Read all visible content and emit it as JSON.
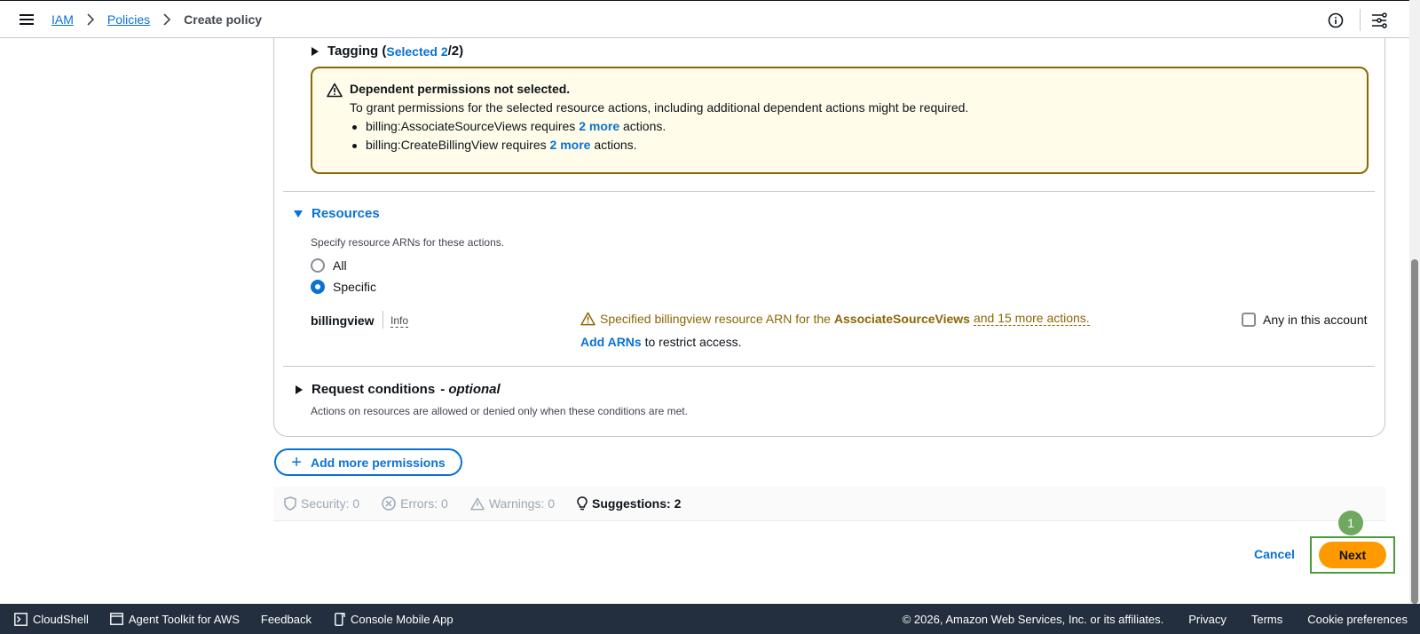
{
  "breadcrumb": {
    "items": [
      "IAM",
      "Policies"
    ],
    "current": "Create policy"
  },
  "tagging": {
    "label": "Tagging (",
    "selected": "Selected 2",
    "suffix": "/2)"
  },
  "alert": {
    "title": "Dependent permissions not selected.",
    "text": "To grant permissions for the selected resource actions, including additional dependent actions might be required.",
    "items": [
      {
        "action": "billing:AssociateSourceViews requires ",
        "link": "2 more",
        "after": " actions."
      },
      {
        "action": "billing:CreateBillingView requires ",
        "link": "2 more",
        "after": " actions."
      }
    ]
  },
  "resources": {
    "heading": "Resources",
    "description": "Specify resource ARNs for these actions.",
    "options": [
      "All",
      "Specific"
    ],
    "selected": "Specific",
    "billingview": {
      "label": "billingview",
      "info": "Info",
      "warning_prefix": "Specified billingview resource ARN for the",
      "warning_action": "AssociateSourceViews",
      "warning_more": "and 15 more actions.",
      "add_arns": "Add ARNs",
      "add_arns_suffix": " to restrict access.",
      "any_account": "Any in this account"
    }
  },
  "request_conditions": {
    "heading": "Request conditions",
    "optional": "- optional",
    "description": "Actions on resources are allowed or denied only when these conditions are met."
  },
  "add_more_permissions": "Add more permissions",
  "summary": {
    "security": "Security: 0",
    "errors": "Errors: 0",
    "warnings": "Warnings: 0",
    "suggestions": "Suggestions: 2"
  },
  "actions": {
    "cancel": "Cancel",
    "next": "Next",
    "step_badge": "1"
  },
  "footer": {
    "cloudshell": "CloudShell",
    "agent_toolkit": "Agent Toolkit for AWS",
    "feedback": "Feedback",
    "mobile_app": "Console Mobile App",
    "copyright": "© 2026, Amazon Web Services, Inc. or its affiliates.",
    "privacy": "Privacy",
    "terms": "Terms",
    "cookie": "Cookie preferences"
  },
  "colors": {
    "link": "#0972d3",
    "warning": "#8d6605",
    "warning_bg": "#fffce9",
    "primary_button": "#ff9900",
    "footer_bg": "#232f3e"
  }
}
